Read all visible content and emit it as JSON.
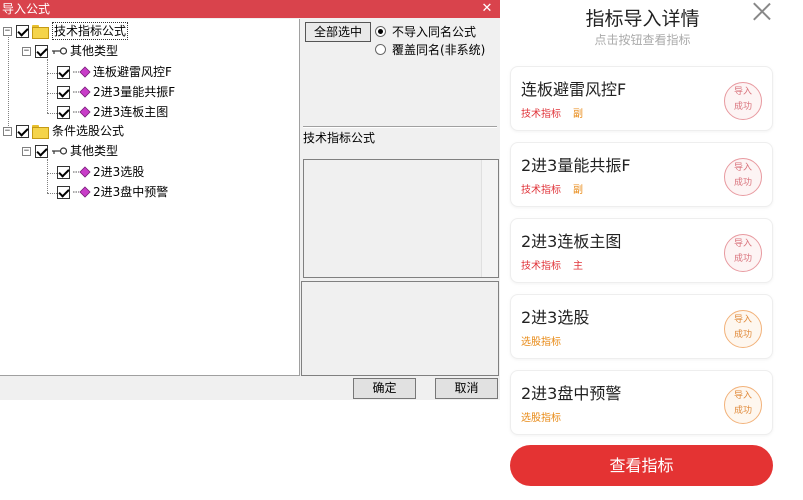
{
  "dialog": {
    "title": "导入公式",
    "close_glyph": "✕",
    "tree": {
      "group1": {
        "label": "技术指标公式",
        "type_label": "其他类型",
        "items": [
          "连板避雷风控F",
          "2进3量能共振F",
          "2进3连板主图"
        ]
      },
      "group2": {
        "label": "条件选股公式",
        "type_label": "其他类型",
        "items": [
          "2进3选股",
          "2进3盘中预警"
        ]
      }
    },
    "select_all_label": "全部选中",
    "radio_no_import": "不导入同名公式",
    "radio_overwrite": "覆盖同名(非系统)",
    "info_label": "技术指标公式",
    "ok_label": "确定",
    "cancel_label": "取消"
  },
  "panel": {
    "title": "指标导入详情",
    "subtitle": "点击按钮查看指标",
    "cards": [
      {
        "title": "连板避雷风控F",
        "tag": "技术指标",
        "sub": "副",
        "stamp_l1": "导入",
        "stamp_l2": "成功"
      },
      {
        "title": "2进3量能共振F",
        "tag": "技术指标",
        "sub": "副",
        "stamp_l1": "导入",
        "stamp_l2": "成功"
      },
      {
        "title": "2进3连板主图",
        "tag": "技术指标",
        "sub": "主",
        "stamp_l1": "导入",
        "stamp_l2": "成功"
      },
      {
        "title": "2进3选股",
        "tag": "选股指标",
        "sub": "",
        "stamp_l1": "导入",
        "stamp_l2": "成功"
      },
      {
        "title": "2进3盘中预警",
        "tag": "选股指标",
        "sub": "",
        "stamp_l1": "导入",
        "stamp_l2": "成功"
      }
    ],
    "button_label": "查看指标"
  },
  "colors": {
    "titlebar": "#d9434c",
    "tag_tech": "#e0353b",
    "tag_select": "#e88a16",
    "stamp_red": "#e89aa0",
    "stamp_orange": "#f2b27a",
    "primary_button": "#e43333"
  },
  "icons": {
    "folder": "folder-icon",
    "type": "key-icon",
    "formula": "formula-diamond-icon",
    "close": "close-icon"
  }
}
